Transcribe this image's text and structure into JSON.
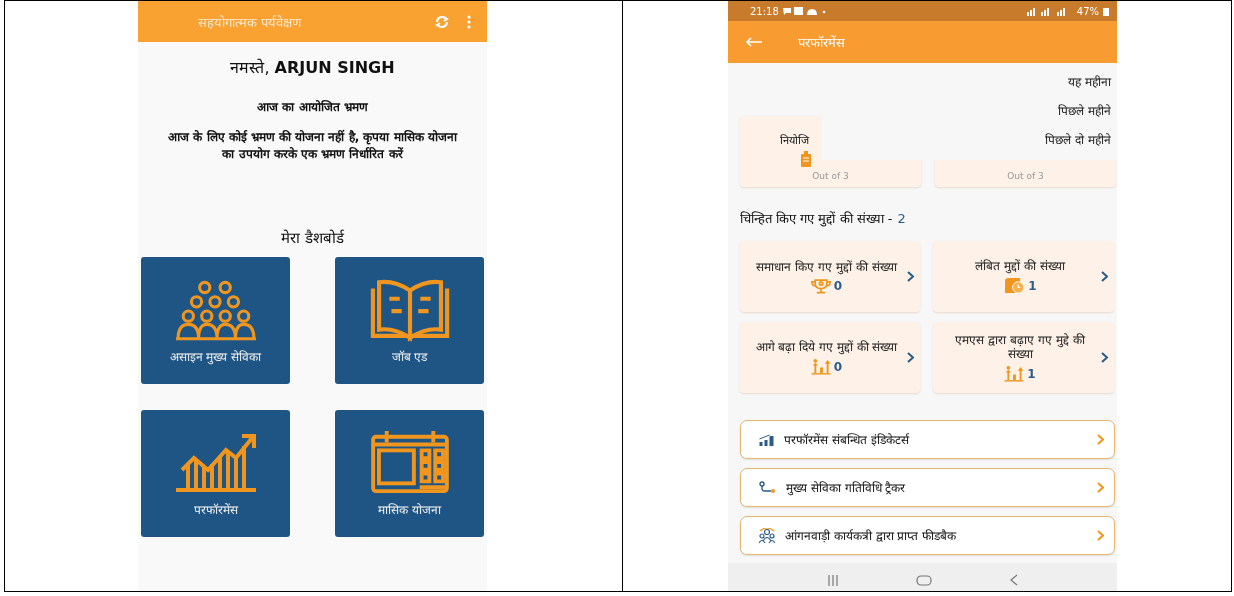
{
  "left_screen": {
    "app_bar": {
      "title": "सहयोगात्मक पर्यवेक्षण"
    },
    "greeting": "नमस्ते, **ARJUN SINGH**",
    "planned_visits_heading": "आज का आयोजित भ्रमण",
    "message": "आज के लिए कोई भ्रमण की योजना नहीं है, कृपया मासिक योजना का उपयोग करके एक भ्रमण निर्धारित करें",
    "dashboard_heading": "मेरा डैशबोर्ड",
    "tiles": [
      {
        "label": "असाइन मुख्य सेविका",
        "kind": "people"
      },
      {
        "label": "जॉब एड",
        "kind": "book"
      },
      {
        "label": "परफॉरमेंस",
        "kind": "chart"
      },
      {
        "label": "मासिक योजना",
        "kind": "calendar"
      }
    ]
  },
  "right_screen": {
    "status_bar": {
      "time": "21:18",
      "battery": "47%"
    },
    "app_bar": {
      "title": "परफॉरमेंस"
    },
    "summary_cards": [
      {
        "title": "नियोजि",
        "caption": "Out of 3"
      },
      {
        "caption": "Out of 3"
      }
    ],
    "period_menu": [
      {
        "label": "यह महीना"
      },
      {
        "label": "पिछले महीने"
      },
      {
        "label": "पिछले दो महीने"
      }
    ],
    "issues_heading": {
      "label": "चिन्हित किए गए मुद्दों की संख्या -",
      "count": "2"
    },
    "issue_cards": [
      {
        "label": "समाधान किए गए मुद्दों की संख्या",
        "count": "0",
        "kind": "trophy"
      },
      {
        "label": "लंबित मुद्दों की संख्या",
        "count": "1",
        "kind": "pending"
      },
      {
        "label": "आगे बढ़ा दिये गए मुद्दों की संख्या",
        "count": "0",
        "kind": "escalate"
      },
      {
        "label": "एमएस द्वारा बढ़ाए गए मुद्दे की संख्या",
        "count": "1",
        "kind": "escalate"
      }
    ],
    "links": [
      {
        "label": "परफॉरमेंस संबन्धित इंडिकेटर्स",
        "kind": "indicators"
      },
      {
        "label": "मुख्य सेविका गतिविधि ट्रैकर",
        "kind": "route"
      },
      {
        "label": "आंगनवाड़ी कार्यकत्री द्वारा प्राप्त फीडबैक",
        "kind": "group"
      }
    ]
  }
}
